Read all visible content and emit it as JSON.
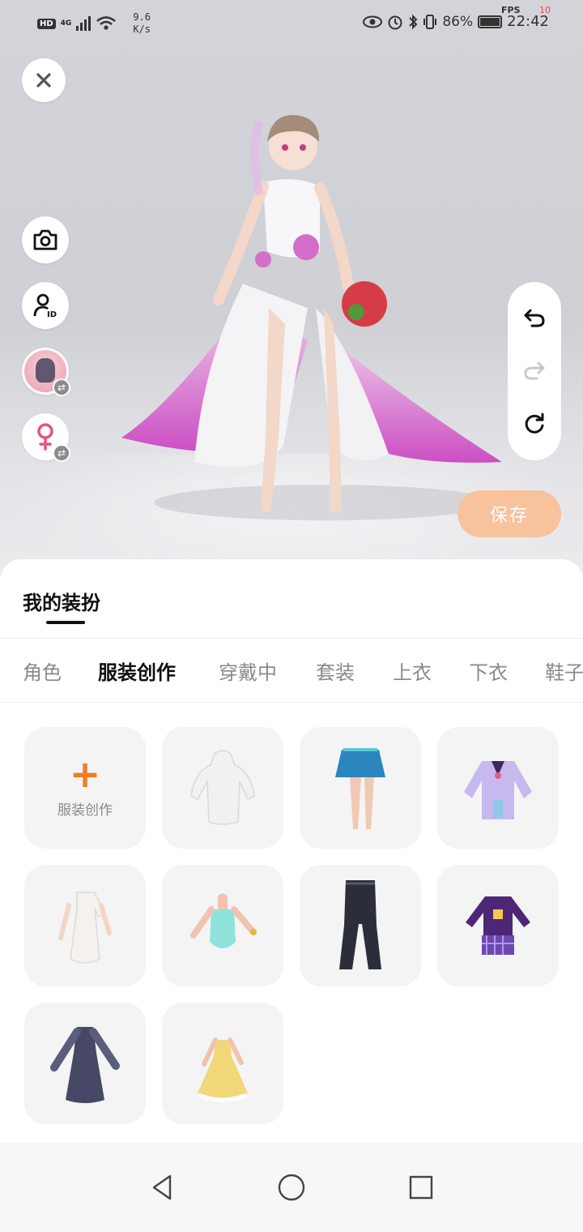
{
  "status_bar": {
    "network_badge": "HD",
    "network_type": "4G",
    "speed_value": "9.6",
    "speed_unit": "K/s",
    "battery": "86%",
    "time": "22:42",
    "fps_label": "FPS",
    "fps_value": "10"
  },
  "stage": {
    "save_label": "保存"
  },
  "sheet": {
    "title": "我的装扮",
    "tabs": [
      {
        "label": "角色",
        "active": false
      },
      {
        "label": "服装创作",
        "active": true
      },
      {
        "label": "穿戴中",
        "active": false
      },
      {
        "label": "套装",
        "active": false
      },
      {
        "label": "上衣",
        "active": false
      },
      {
        "label": "下衣",
        "active": false
      },
      {
        "label": "鞋子",
        "active": false
      }
    ],
    "create_tile_label": "服装创作",
    "items": [
      {
        "name": "white-hooded-dress-item"
      },
      {
        "name": "blue-pleated-skirt-item"
      },
      {
        "name": "lavender-jacket-item"
      },
      {
        "name": "white-ruffle-dress-item"
      },
      {
        "name": "teal-bodysuit-item"
      },
      {
        "name": "black-flare-pants-item"
      },
      {
        "name": "purple-plaid-outfit-item"
      },
      {
        "name": "gray-long-gown-item"
      },
      {
        "name": "yellow-ball-gown-item"
      }
    ]
  },
  "colors": {
    "accent": "#f47a20",
    "save_button": "#f8c29d",
    "tile_bg": "#f4f4f5"
  }
}
